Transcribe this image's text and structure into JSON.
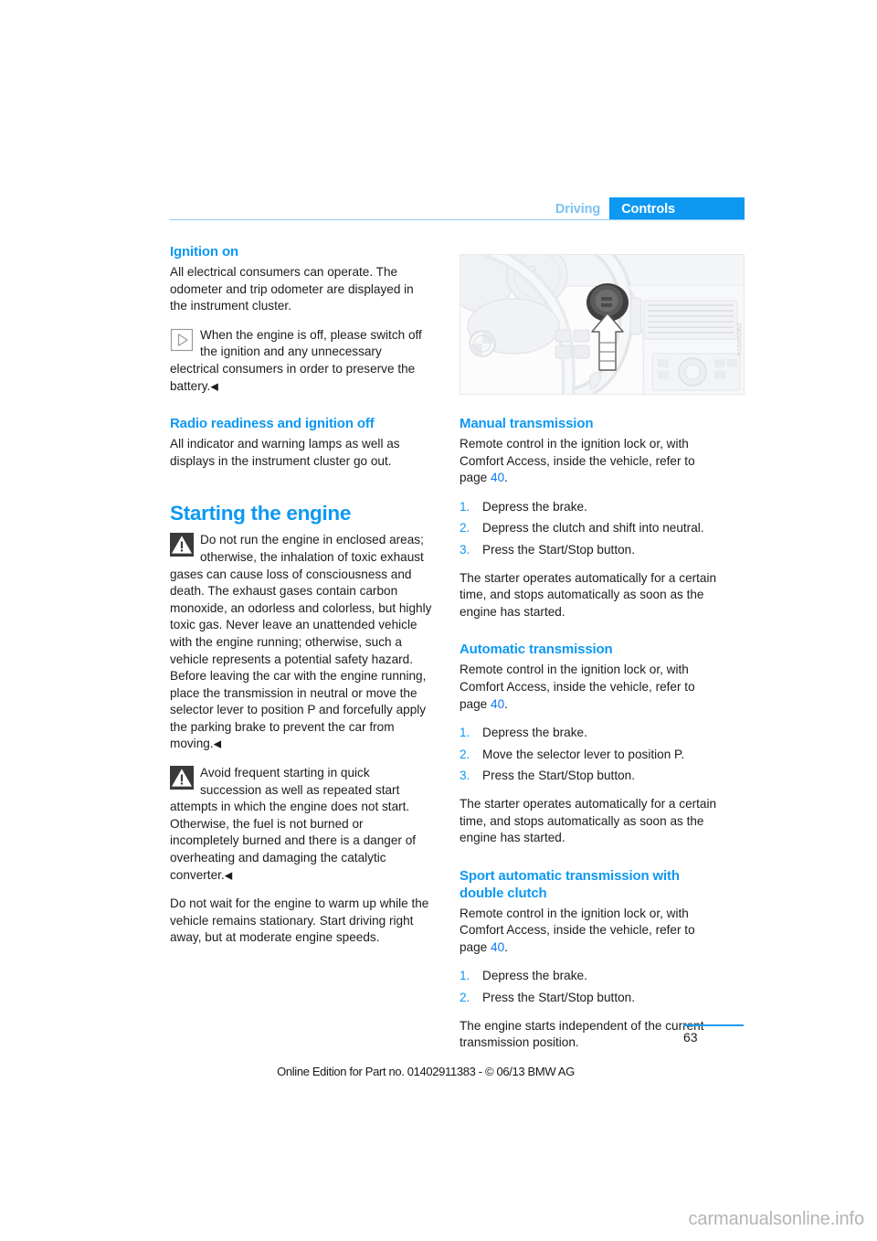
{
  "header": {
    "tab_inactive": "Driving",
    "tab_active": "Controls",
    "accent_color": "#0d98f2",
    "inactive_color": "#7cc2f2"
  },
  "left_column": {
    "section1_heading": "Ignition on",
    "section1_p1": "All electrical consumers can operate. The odometer and trip odometer are displayed in the instrument cluster.",
    "section1_note_icon": "play-triangle-icon",
    "section1_note": "When the engine is off, please switch off the ignition and any unnecessary electrical consumers in order to preserve the battery.",
    "section2_heading": "Radio readiness and ignition off",
    "section2_p1": "All indicator and warning lamps as well as displays in the instrument cluster go out.",
    "chapter_heading": "Starting the engine",
    "warning1_icon": "warning-triangle-icon",
    "warning1": "Do not run the engine in enclosed areas; otherwise, the inhalation of toxic exhaust gases can cause loss of consciousness and death. The exhaust gases contain carbon monoxide, an odorless and colorless, but highly toxic gas. Never leave an unattended vehicle with the engine running; otherwise, such a vehicle represents a potential safety hazard. Before leaving the car with the engine running, place the transmission in neutral or move the selector lever to position P and forcefully apply the parking brake to prevent the car from moving.",
    "warning2_icon": "warning-triangle-icon",
    "warning2": "Avoid frequent starting in quick succession as well as repeated start attempts in which the engine does not start. Otherwise, the fuel is not burned or incompletely burned and there is a danger of overheating and damaging the catalytic converter.",
    "closing_p": "Do not wait for the engine to warm up while the vehicle remains stationary. Start driving right away, but at moderate engine speeds.",
    "end_mark": "◀"
  },
  "figure": {
    "alt": "steering-wheel-and-ignition-lock-illustration",
    "code": "VW2005VA"
  },
  "right_column": {
    "manual": {
      "heading": "Manual transmission",
      "intro_pre": "Remote control in the ignition lock or, with Comfort Access, inside the vehicle, refer to page ",
      "intro_ref": "40",
      "intro_post": ".",
      "steps": [
        "Depress the brake.",
        "Depress the clutch and shift into neutral.",
        "Press the Start/Stop button."
      ],
      "outro": "The starter operates automatically for a certain time, and stops automatically as soon as the engine has started."
    },
    "automatic": {
      "heading": "Automatic transmission",
      "intro_pre": "Remote control in the ignition lock or, with Comfort Access, inside the vehicle, refer to page ",
      "intro_ref": "40",
      "intro_post": ".",
      "steps": [
        "Depress the brake.",
        "Move the selector lever to position P.",
        "Press the Start/Stop button."
      ],
      "outro": "The starter operates automatically for a certain time, and stops automatically as soon as the engine has started."
    },
    "sport": {
      "heading": "Sport automatic transmission with double clutch",
      "intro_pre": "Remote control in the ignition lock or, with Comfort Access, inside the vehicle, refer to page ",
      "intro_ref": "40",
      "intro_post": ".",
      "steps": [
        "Depress the brake.",
        "Press the Start/Stop button."
      ],
      "outro": "The engine starts independent of the current transmission position."
    }
  },
  "footer": {
    "page_number": "63",
    "edition_note": "Online Edition for Part no. 01402911383 - © 06/13 BMW AG",
    "watermark": "carmanualsonline.info"
  }
}
